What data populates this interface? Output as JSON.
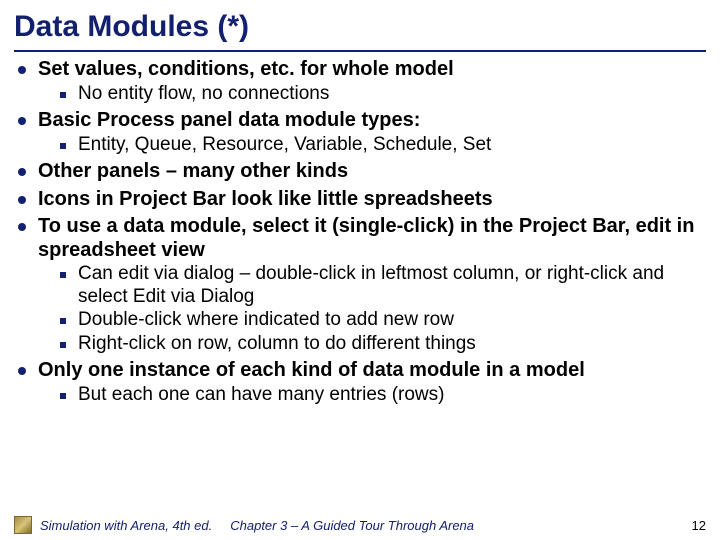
{
  "title": "Data Modules (*)",
  "bullets": {
    "b0": "Set values, conditions, etc. for whole model",
    "b0s0": "No entity flow, no connections",
    "b1": "Basic Process panel data module types:",
    "b1s0": "Entity, Queue, Resource, Variable, Schedule, Set",
    "b2": "Other panels – many other kinds",
    "b3": "Icons in Project Bar look like little spreadsheets",
    "b4": "To use a data module, select it (single-click) in the Project Bar, edit in spreadsheet view",
    "b4s0": "Can edit via dialog – double-click in leftmost column, or right-click and select Edit via Dialog",
    "b4s1": "Double-click where indicated to add new row",
    "b4s2": "Right-click on row, column to do different things",
    "b5": "Only one instance of each kind of data module in a model",
    "b5s0": "But each one can have many entries (rows)"
  },
  "footer": {
    "book": "Simulation with Arena, 4th ed.",
    "chapter": "Chapter 3 – A Guided Tour Through Arena",
    "page": "12"
  }
}
